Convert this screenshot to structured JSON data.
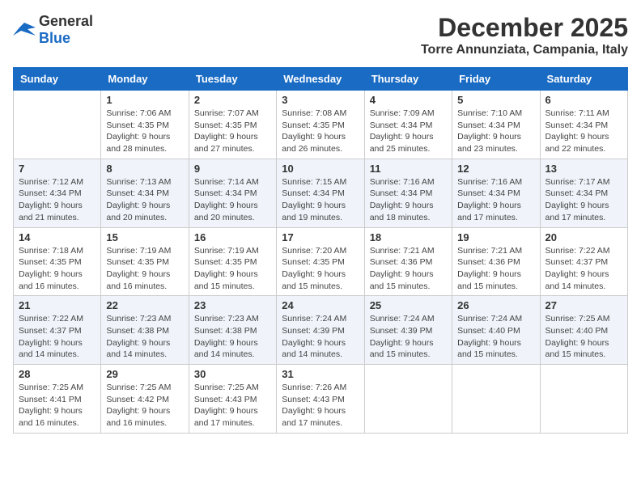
{
  "header": {
    "logo_general": "General",
    "logo_blue": "Blue",
    "month": "December 2025",
    "location": "Torre Annunziata, Campania, Italy"
  },
  "days_of_week": [
    "Sunday",
    "Monday",
    "Tuesday",
    "Wednesday",
    "Thursday",
    "Friday",
    "Saturday"
  ],
  "weeks": [
    [
      {
        "day": "",
        "sunrise": "",
        "sunset": "",
        "daylight": ""
      },
      {
        "day": "1",
        "sunrise": "Sunrise: 7:06 AM",
        "sunset": "Sunset: 4:35 PM",
        "daylight": "Daylight: 9 hours and 28 minutes."
      },
      {
        "day": "2",
        "sunrise": "Sunrise: 7:07 AM",
        "sunset": "Sunset: 4:35 PM",
        "daylight": "Daylight: 9 hours and 27 minutes."
      },
      {
        "day": "3",
        "sunrise": "Sunrise: 7:08 AM",
        "sunset": "Sunset: 4:35 PM",
        "daylight": "Daylight: 9 hours and 26 minutes."
      },
      {
        "day": "4",
        "sunrise": "Sunrise: 7:09 AM",
        "sunset": "Sunset: 4:34 PM",
        "daylight": "Daylight: 9 hours and 25 minutes."
      },
      {
        "day": "5",
        "sunrise": "Sunrise: 7:10 AM",
        "sunset": "Sunset: 4:34 PM",
        "daylight": "Daylight: 9 hours and 23 minutes."
      },
      {
        "day": "6",
        "sunrise": "Sunrise: 7:11 AM",
        "sunset": "Sunset: 4:34 PM",
        "daylight": "Daylight: 9 hours and 22 minutes."
      }
    ],
    [
      {
        "day": "7",
        "sunrise": "Sunrise: 7:12 AM",
        "sunset": "Sunset: 4:34 PM",
        "daylight": "Daylight: 9 hours and 21 minutes."
      },
      {
        "day": "8",
        "sunrise": "Sunrise: 7:13 AM",
        "sunset": "Sunset: 4:34 PM",
        "daylight": "Daylight: 9 hours and 20 minutes."
      },
      {
        "day": "9",
        "sunrise": "Sunrise: 7:14 AM",
        "sunset": "Sunset: 4:34 PM",
        "daylight": "Daylight: 9 hours and 20 minutes."
      },
      {
        "day": "10",
        "sunrise": "Sunrise: 7:15 AM",
        "sunset": "Sunset: 4:34 PM",
        "daylight": "Daylight: 9 hours and 19 minutes."
      },
      {
        "day": "11",
        "sunrise": "Sunrise: 7:16 AM",
        "sunset": "Sunset: 4:34 PM",
        "daylight": "Daylight: 9 hours and 18 minutes."
      },
      {
        "day": "12",
        "sunrise": "Sunrise: 7:16 AM",
        "sunset": "Sunset: 4:34 PM",
        "daylight": "Daylight: 9 hours and 17 minutes."
      },
      {
        "day": "13",
        "sunrise": "Sunrise: 7:17 AM",
        "sunset": "Sunset: 4:34 PM",
        "daylight": "Daylight: 9 hours and 17 minutes."
      }
    ],
    [
      {
        "day": "14",
        "sunrise": "Sunrise: 7:18 AM",
        "sunset": "Sunset: 4:35 PM",
        "daylight": "Daylight: 9 hours and 16 minutes."
      },
      {
        "day": "15",
        "sunrise": "Sunrise: 7:19 AM",
        "sunset": "Sunset: 4:35 PM",
        "daylight": "Daylight: 9 hours and 16 minutes."
      },
      {
        "day": "16",
        "sunrise": "Sunrise: 7:19 AM",
        "sunset": "Sunset: 4:35 PM",
        "daylight": "Daylight: 9 hours and 15 minutes."
      },
      {
        "day": "17",
        "sunrise": "Sunrise: 7:20 AM",
        "sunset": "Sunset: 4:35 PM",
        "daylight": "Daylight: 9 hours and 15 minutes."
      },
      {
        "day": "18",
        "sunrise": "Sunrise: 7:21 AM",
        "sunset": "Sunset: 4:36 PM",
        "daylight": "Daylight: 9 hours and 15 minutes."
      },
      {
        "day": "19",
        "sunrise": "Sunrise: 7:21 AM",
        "sunset": "Sunset: 4:36 PM",
        "daylight": "Daylight: 9 hours and 15 minutes."
      },
      {
        "day": "20",
        "sunrise": "Sunrise: 7:22 AM",
        "sunset": "Sunset: 4:37 PM",
        "daylight": "Daylight: 9 hours and 14 minutes."
      }
    ],
    [
      {
        "day": "21",
        "sunrise": "Sunrise: 7:22 AM",
        "sunset": "Sunset: 4:37 PM",
        "daylight": "Daylight: 9 hours and 14 minutes."
      },
      {
        "day": "22",
        "sunrise": "Sunrise: 7:23 AM",
        "sunset": "Sunset: 4:38 PM",
        "daylight": "Daylight: 9 hours and 14 minutes."
      },
      {
        "day": "23",
        "sunrise": "Sunrise: 7:23 AM",
        "sunset": "Sunset: 4:38 PM",
        "daylight": "Daylight: 9 hours and 14 minutes."
      },
      {
        "day": "24",
        "sunrise": "Sunrise: 7:24 AM",
        "sunset": "Sunset: 4:39 PM",
        "daylight": "Daylight: 9 hours and 14 minutes."
      },
      {
        "day": "25",
        "sunrise": "Sunrise: 7:24 AM",
        "sunset": "Sunset: 4:39 PM",
        "daylight": "Daylight: 9 hours and 15 minutes."
      },
      {
        "day": "26",
        "sunrise": "Sunrise: 7:24 AM",
        "sunset": "Sunset: 4:40 PM",
        "daylight": "Daylight: 9 hours and 15 minutes."
      },
      {
        "day": "27",
        "sunrise": "Sunrise: 7:25 AM",
        "sunset": "Sunset: 4:40 PM",
        "daylight": "Daylight: 9 hours and 15 minutes."
      }
    ],
    [
      {
        "day": "28",
        "sunrise": "Sunrise: 7:25 AM",
        "sunset": "Sunset: 4:41 PM",
        "daylight": "Daylight: 9 hours and 16 minutes."
      },
      {
        "day": "29",
        "sunrise": "Sunrise: 7:25 AM",
        "sunset": "Sunset: 4:42 PM",
        "daylight": "Daylight: 9 hours and 16 minutes."
      },
      {
        "day": "30",
        "sunrise": "Sunrise: 7:25 AM",
        "sunset": "Sunset: 4:43 PM",
        "daylight": "Daylight: 9 hours and 17 minutes."
      },
      {
        "day": "31",
        "sunrise": "Sunrise: 7:26 AM",
        "sunset": "Sunset: 4:43 PM",
        "daylight": "Daylight: 9 hours and 17 minutes."
      },
      {
        "day": "",
        "sunrise": "",
        "sunset": "",
        "daylight": ""
      },
      {
        "day": "",
        "sunrise": "",
        "sunset": "",
        "daylight": ""
      },
      {
        "day": "",
        "sunrise": "",
        "sunset": "",
        "daylight": ""
      }
    ]
  ]
}
